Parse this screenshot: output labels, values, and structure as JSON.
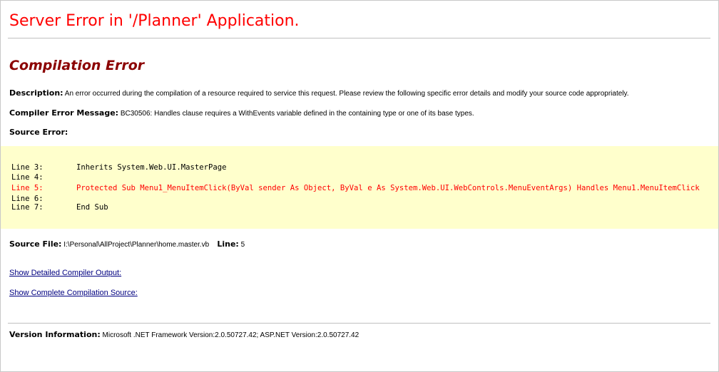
{
  "page": {
    "title": "Server Error in '/Planner' Application.",
    "subtitle": "Compilation Error"
  },
  "description": {
    "label": "Description:",
    "text": "An error occurred during the compilation of a resource required to service this request. Please review the following specific error details and modify your source code appropriately."
  },
  "compiler_error": {
    "label": "Compiler Error Message:",
    "text": "BC30506: Handles clause requires a WithEvents variable defined in the containing type or one of its base types."
  },
  "source_error": {
    "label": "Source Error:",
    "lines": [
      {
        "num": "Line 3:",
        "code": "Inherits System.Web.UI.MasterPage",
        "error": false
      },
      {
        "num": "Line 4:",
        "code": "",
        "error": false
      },
      {
        "num": "Line 5:",
        "code": "Protected Sub Menu1_MenuItemClick(ByVal sender As Object, ByVal e As System.Web.UI.WebControls.MenuEventArgs) Handles Menu1.MenuItemClick",
        "error": true
      },
      {
        "num": "Line 6:",
        "code": "",
        "error": false
      },
      {
        "num": "Line 7:",
        "code": "End Sub",
        "error": false
      }
    ]
  },
  "source_file": {
    "label": "Source File:",
    "path": "I:\\Personal\\AllProject\\Planner\\home.master.vb",
    "line_label": "Line:",
    "line_value": "5"
  },
  "links": {
    "detailed_output": "Show Detailed Compiler Output:",
    "complete_source": "Show Complete Compilation Source:"
  },
  "version": {
    "label": "Version Information:",
    "text": "Microsoft .NET Framework Version:2.0.50727.42; ASP.NET Version:2.0.50727.42"
  },
  "colors": {
    "title": "#ff0000",
    "subtitle": "#8b0000",
    "code_background": "#ffffcc",
    "error_line": "#ff0000",
    "link": "#000080"
  }
}
